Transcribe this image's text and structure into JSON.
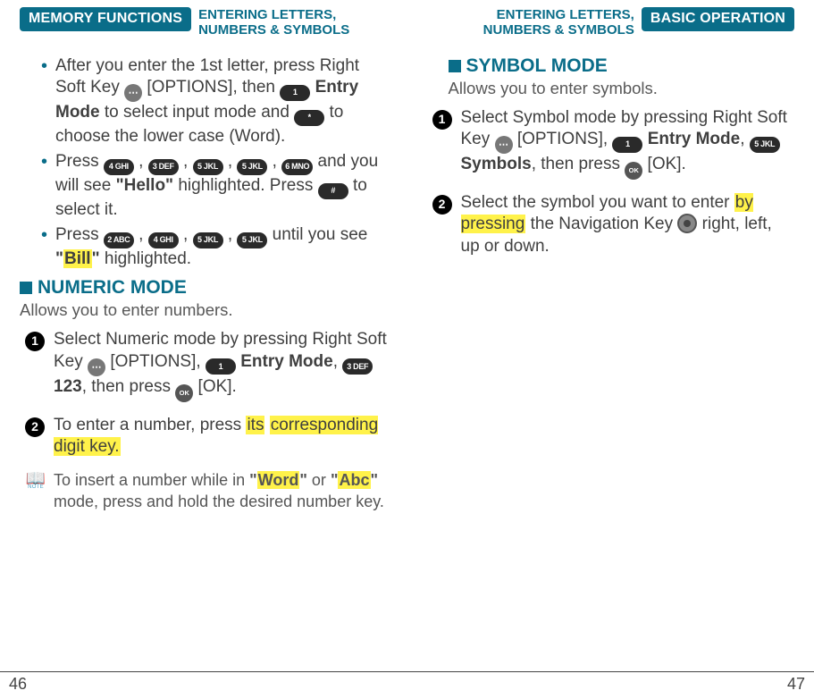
{
  "left": {
    "tab": "MEMORY FUNCTIONS",
    "running_head_l1": "ENTERING LETTERS,",
    "running_head_l2": "NUMBERS & SYMBOLS",
    "bullets": {
      "b1_a": "After you enter the 1st letter, press Right Soft Key",
      "b1_b": "[OPTIONS], then",
      "b1_key1": "1",
      "b1_c": "Entry Mode",
      "b1_d": "to select input mode and",
      "b1_key2": "*",
      "b1_e": "to choose the lower case (Word).",
      "b2_a": "Press",
      "b2_k1": "4 GHI",
      "b2_k2": "3 DEF",
      "b2_k3": "5 JKL",
      "b2_k4": "5 JKL",
      "b2_k5": "6 MNO",
      "b2_b": "and you will see",
      "b2_q": "\"Hello\"",
      "b2_c": "highlighted. Press",
      "b2_k6": "#",
      "b2_d": "to select it.",
      "b3_a": "Press",
      "b3_k1": "2 ABC",
      "b3_k2": "4 GHI",
      "b3_k3": "5 JKL",
      "b3_k4": "5 JKL",
      "b3_b": "until you see",
      "b3_q1": "\"",
      "b3_hl": "Bill",
      "b3_q2": "\"",
      "b3_c": "highlighted."
    },
    "numeric": {
      "title": "NUMERIC MODE",
      "sub": "Allows you to enter numbers.",
      "s1_a": "Select Numeric mode by pressing Right Soft Key",
      "s1_b": "[OPTIONS],",
      "s1_k1": "1",
      "s1_c": "Entry Mode",
      "s1_k2": "3 DEF",
      "s1_d": "123",
      "s1_e": ", then press",
      "s1_f": "[OK].",
      "s2_a": "To enter a number, press",
      "s2_hl1": "its",
      "s2_hl2": "corresponding digit key.",
      "note_a": "To insert a number while in",
      "note_q1_hl": "Word",
      "note_b": "or",
      "note_q2_hl": "Abc",
      "note_c": "mode, press and hold the desired number key."
    },
    "page_no": "46"
  },
  "right": {
    "running_head_l1": "ENTERING LETTERS,",
    "running_head_l2": "NUMBERS & SYMBOLS",
    "tab": "BASIC OPERATION",
    "symbol": {
      "title": "SYMBOL MODE",
      "sub": "Allows you to enter symbols.",
      "s1_a": "Select Symbol mode by pressing Right Soft Key",
      "s1_b": "[OPTIONS],",
      "s1_k1": "1",
      "s1_c": "Entry Mode",
      "s1_k2": "5 JKL",
      "s1_d": "Symbols",
      "s1_e": ", then press",
      "s1_f": "[OK].",
      "s2_a": "Select the symbol you want to enter",
      "s2_hl": "by pressing",
      "s2_b": "the Navigation Key",
      "s2_c": "right, left, up or down."
    },
    "page_no": "47"
  }
}
